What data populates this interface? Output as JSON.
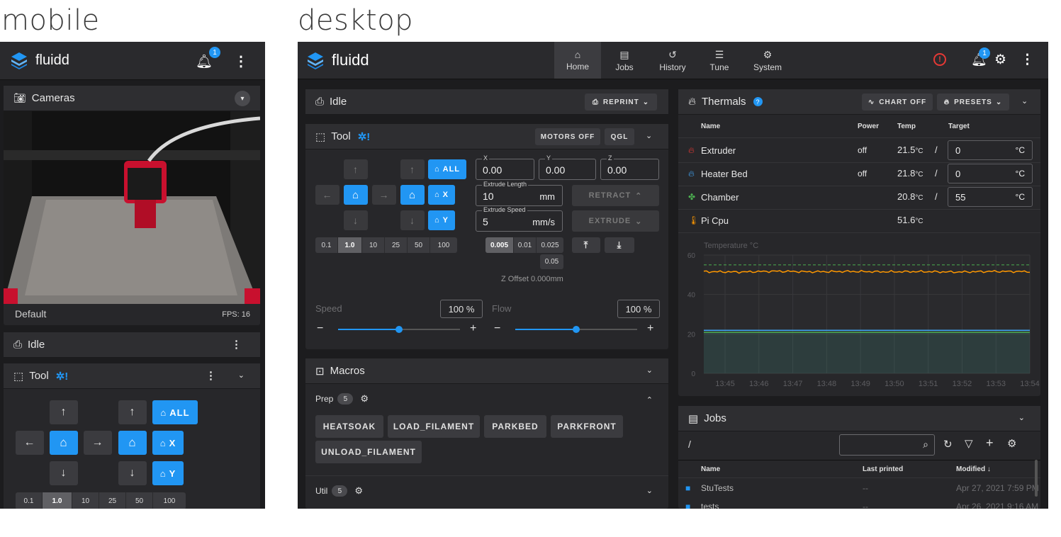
{
  "captions": {
    "mobile": "mobile",
    "desktop": "desktop"
  },
  "app": {
    "name": "fluidd",
    "notif_count": "1"
  },
  "nav": [
    {
      "label": "Home",
      "icon": "home-icon"
    },
    {
      "label": "Jobs",
      "icon": "file-icon"
    },
    {
      "label": "History",
      "icon": "history-icon"
    },
    {
      "label": "Tune",
      "icon": "tune-icon"
    },
    {
      "label": "System",
      "icon": "cogs-icon"
    }
  ],
  "status": {
    "title": "Idle",
    "reprint": "REPRINT"
  },
  "tool": {
    "title": "Tool",
    "motors_off": "MOTORS OFF",
    "qgl": "QGL",
    "home_all": "ALL",
    "home_x": "X",
    "home_y": "Y",
    "steps": [
      "0.1",
      "1.0",
      "10",
      "25",
      "50",
      "100"
    ],
    "z_steps": [
      "0.005",
      "0.01",
      "0.025",
      "0.05"
    ],
    "x_label": "X",
    "x_val": "0.00",
    "y_label": "Y",
    "y_val": "0.00",
    "z_label": "Z",
    "z_val": "0.00",
    "extrude_len_label": "Extrude Length",
    "extrude_len": "10",
    "extrude_len_unit": "mm",
    "extrude_speed_label": "Extrude Speed",
    "extrude_speed": "5",
    "extrude_speed_unit": "mm/s",
    "retract": "RETRACT",
    "extrude": "EXTRUDE",
    "z_offset_label": "Z Offset",
    "z_offset_val": "0.000mm",
    "speed_label": "Speed",
    "speed_val": "100 %",
    "flow_label": "Flow",
    "flow_val": "100 %"
  },
  "macros": {
    "title": "Macros",
    "groups": [
      {
        "name": "Prep",
        "count": "5",
        "items": [
          "HEATSOAK",
          "LOAD_FILAMENT",
          "PARKBED",
          "PARKFRONT",
          "UNLOAD_FILAMENT"
        ]
      },
      {
        "name": "Util",
        "count": "5",
        "items": []
      }
    ]
  },
  "thermals": {
    "title": "Thermals",
    "chart_off": "CHART OFF",
    "presets": "PRESETS",
    "headers": {
      "name": "Name",
      "power": "Power",
      "temp": "Temp",
      "target": "Target"
    },
    "rows": [
      {
        "name": "Extruder",
        "power": "off",
        "temp": "21.5",
        "target": "0",
        "color": "#e53935",
        "icon": "flame-icon"
      },
      {
        "name": "Heater Bed",
        "power": "off",
        "temp": "21.8",
        "target": "0",
        "color": "#42a5f5",
        "icon": "flame-icon"
      },
      {
        "name": "Chamber",
        "power": "",
        "temp": "20.8",
        "target": "55",
        "color": "#4caf50",
        "icon": "fan-icon"
      },
      {
        "name": "Pi Cpu",
        "power": "",
        "temp": "51.6",
        "target": "",
        "color": "#ff9800",
        "icon": "thermometer-icon"
      }
    ],
    "temp_unit": "°C",
    "target_unit": "°C"
  },
  "chart_data": {
    "type": "line",
    "ylabel": "Temperature °C",
    "ylim": [
      0,
      60
    ],
    "y_ticks": [
      "60",
      "40",
      "20",
      "0"
    ],
    "x": [
      "13:45",
      "13:46",
      "13:47",
      "13:48",
      "13:49",
      "13:50",
      "13:51",
      "13:52",
      "13:53",
      "13:54"
    ],
    "series": [
      {
        "name": "Extruder",
        "color": "#ff9800",
        "values": [
          51.6,
          51.4,
          51.8,
          51.5,
          51.7,
          51.5,
          51.6,
          51.4,
          51.7,
          51.6
        ]
      },
      {
        "name": "Heater Bed",
        "color": "#42a5f5",
        "values": [
          21.8,
          21.8,
          21.8,
          21.8,
          21.8,
          21.8,
          21.8,
          21.8,
          21.8,
          21.8
        ]
      },
      {
        "name": "Chamber",
        "color": "#4caf50",
        "values": [
          20.8,
          20.8,
          20.8,
          20.8,
          20.8,
          20.8,
          20.8,
          20.8,
          20.8,
          20.8
        ]
      }
    ],
    "target_line": 55,
    "grid": true
  },
  "jobs": {
    "title": "Jobs",
    "path": "/",
    "headers": {
      "name": "Name",
      "last_printed": "Last printed",
      "modified": "Modified"
    },
    "rows": [
      {
        "name": "StuTests",
        "last_printed": "--",
        "modified": "Apr 27, 2021 7:59 PM"
      },
      {
        "name": "tests",
        "last_printed": "--",
        "modified": "Apr 26, 2021 9:16 AM"
      }
    ]
  },
  "mobile": {
    "cameras_title": "Cameras",
    "camera_name": "Default",
    "fps": "FPS: 16",
    "status": "Idle",
    "tool": "Tool"
  }
}
